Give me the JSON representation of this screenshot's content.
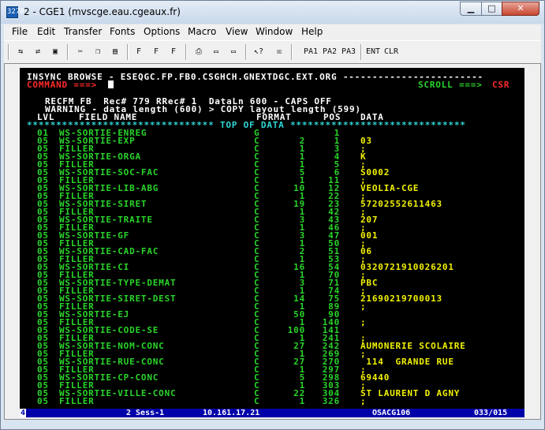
{
  "window": {
    "title": "2 - CGE1 (mvscge.eau.cgeaux.fr)",
    "icon_text": "3270",
    "min_glyph": "▁",
    "max_glyph": "□",
    "close_glyph": "✕"
  },
  "menu": [
    "File",
    "Edit",
    "Transfer",
    "Fonts",
    "Options",
    "Macro",
    "View",
    "Window",
    "Help"
  ],
  "toolbar": {
    "pa1": "PA1",
    "pa2": "PA2",
    "pa3": "PA3",
    "ent": "ENT",
    "clr": "CLR",
    "f1": "F",
    "f2": "F",
    "f3": "F"
  },
  "terminal": {
    "header": "INSYNC BROWSE - ESEQGC.FP.FB0.CSGHCH.GNEXTDGC.EXT.ORG ------------------------",
    "command_label": "COMMAND ===>",
    "scroll_label": "SCROLL ===>",
    "scroll_value": "CSR",
    "recfm_line": "RECFM FB  Rec# 779 RRec# 1  DataLn 600 - CAPS OFF",
    "warning_line": "WARNING - data length (600) > COPY layout length (599)",
    "col_lvl": "LVL",
    "col_field": "FIELD NAME",
    "col_format": "FORMAT",
    "col_pos": "POS",
    "col_data": "DATA",
    "top_of_data": "******************************** TOP OF DATA ******************************",
    "rows": [
      {
        "lvl": "01",
        "name": "WS-SORTIE-ENREG",
        "fmt": "G",
        "len": "",
        "pos": "1",
        "data": ""
      },
      {
        "lvl": "05",
        "name": "WS-SORTIE-EXP",
        "fmt": "C",
        "len": "2",
        "pos": "1",
        "data": "03"
      },
      {
        "lvl": "05",
        "name": "FILLER",
        "fmt": "C",
        "len": "1",
        "pos": "3",
        "data": ";"
      },
      {
        "lvl": "05",
        "name": "WS-SORTIE-ORGA",
        "fmt": "C",
        "len": "1",
        "pos": "4",
        "data": "K"
      },
      {
        "lvl": "05",
        "name": "FILLER",
        "fmt": "C",
        "len": "1",
        "pos": "5",
        "data": ";"
      },
      {
        "lvl": "05",
        "name": "WS-SORTIE-SOC-FAC",
        "fmt": "C",
        "len": "5",
        "pos": "6",
        "data": "S0002"
      },
      {
        "lvl": "05",
        "name": "FILLER",
        "fmt": "C",
        "len": "1",
        "pos": "11",
        "data": ";"
      },
      {
        "lvl": "05",
        "name": "WS-SORTIE-LIB-ABG",
        "fmt": "C",
        "len": "10",
        "pos": "12",
        "data": "VEOLIA-CGE"
      },
      {
        "lvl": "05",
        "name": "FILLER",
        "fmt": "C",
        "len": "1",
        "pos": "22",
        "data": ";"
      },
      {
        "lvl": "05",
        "name": "WS-SORTIE-SIRET",
        "fmt": "C",
        "len": "19",
        "pos": "23",
        "data": "57202552611463"
      },
      {
        "lvl": "05",
        "name": "FILLER",
        "fmt": "C",
        "len": "1",
        "pos": "42",
        "data": ";"
      },
      {
        "lvl": "05",
        "name": "WS-SORTIE-TRAITE",
        "fmt": "C",
        "len": "3",
        "pos": "43",
        "data": "207"
      },
      {
        "lvl": "05",
        "name": "FILLER",
        "fmt": "C",
        "len": "1",
        "pos": "46",
        "data": ";"
      },
      {
        "lvl": "05",
        "name": "WS-SORTIE-GF",
        "fmt": "C",
        "len": "3",
        "pos": "47",
        "data": "001"
      },
      {
        "lvl": "05",
        "name": "FILLER",
        "fmt": "C",
        "len": "1",
        "pos": "50",
        "data": ";"
      },
      {
        "lvl": "05",
        "name": "WS-SORTIE-CAD-FAC",
        "fmt": "C",
        "len": "2",
        "pos": "51",
        "data": "06"
      },
      {
        "lvl": "05",
        "name": "FILLER",
        "fmt": "C",
        "len": "1",
        "pos": "53",
        "data": ";"
      },
      {
        "lvl": "05",
        "name": "WS-SORTIE-CI",
        "fmt": "C",
        "len": "16",
        "pos": "54",
        "data": "0320721910026201"
      },
      {
        "lvl": "05",
        "name": "FILLER",
        "fmt": "C",
        "len": "1",
        "pos": "70",
        "data": ";"
      },
      {
        "lvl": "05",
        "name": "WS-SORTIE-TYPE-DEMAT",
        "fmt": "C",
        "len": "3",
        "pos": "71",
        "data": "PBC"
      },
      {
        "lvl": "05",
        "name": "FILLER",
        "fmt": "C",
        "len": "1",
        "pos": "74",
        "data": ";"
      },
      {
        "lvl": "05",
        "name": "WS-SORTIE-SIRET-DEST",
        "fmt": "C",
        "len": "14",
        "pos": "75",
        "data": "21690219700013"
      },
      {
        "lvl": "05",
        "name": "FILLER",
        "fmt": "C",
        "len": "1",
        "pos": "89",
        "data": ";"
      },
      {
        "lvl": "05",
        "name": "WS-SORTIE-EJ",
        "fmt": "C",
        "len": "50",
        "pos": "90",
        "data": ""
      },
      {
        "lvl": "05",
        "name": "FILLER",
        "fmt": "C",
        "len": "1",
        "pos": "140",
        "data": ";"
      },
      {
        "lvl": "05",
        "name": "WS-SORTIE-CODE-SE",
        "fmt": "C",
        "len": "100",
        "pos": "141",
        "data": ""
      },
      {
        "lvl": "05",
        "name": "FILLER",
        "fmt": "C",
        "len": "1",
        "pos": "241",
        "data": ";"
      },
      {
        "lvl": "05",
        "name": "WS-SORTIE-NOM-CONC",
        "fmt": "C",
        "len": "27",
        "pos": "242",
        "data": "AUMONERIE SCOLAIRE"
      },
      {
        "lvl": "05",
        "name": "FILLER",
        "fmt": "C",
        "len": "1",
        "pos": "269",
        "data": ";"
      },
      {
        "lvl": "05",
        "name": "WS-SORTIE-RUE-CONC",
        "fmt": "C",
        "len": "27",
        "pos": "270",
        "data": " 114  GRANDE RUE"
      },
      {
        "lvl": "05",
        "name": "FILLER",
        "fmt": "C",
        "len": "1",
        "pos": "297",
        "data": ";"
      },
      {
        "lvl": "05",
        "name": "WS-SORTIE-CP-CONC",
        "fmt": "C",
        "len": "5",
        "pos": "298",
        "data": "69440"
      },
      {
        "lvl": "05",
        "name": "FILLER",
        "fmt": "C",
        "len": "1",
        "pos": "303",
        "data": ";"
      },
      {
        "lvl": "05",
        "name": "WS-SORTIE-VILLE-CONC",
        "fmt": "C",
        "len": "22",
        "pos": "304",
        "data": "ST LAURENT D AGNY"
      },
      {
        "lvl": "05",
        "name": "FILLER",
        "fmt": "C",
        "len": "1",
        "pos": "326",
        "data": ";"
      }
    ]
  },
  "status": {
    "indicator": "4",
    "session": "2 Sess-1",
    "ip": "10.161.17.21",
    "lu": "OSACG106",
    "cursor_pos": "033/015"
  }
}
